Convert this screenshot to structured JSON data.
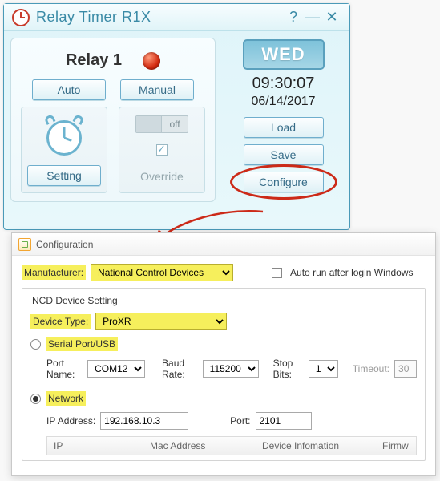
{
  "app": {
    "title": "Relay Timer R1X"
  },
  "relay": {
    "title": "Relay 1",
    "auto": "Auto",
    "manual": "Manual",
    "setting": "Setting",
    "override": "Override",
    "off": "off"
  },
  "clock": {
    "day": "WED",
    "time": "09:30:07",
    "date": "06/14/2017",
    "load": "Load",
    "save": "Save",
    "configure": "Configure"
  },
  "config": {
    "title": "Configuration",
    "manufacturer_label": "Manufacturer:",
    "manufacturer_value": "National Control Devices",
    "autorun_label": "Auto run after login Windows",
    "device_setting_legend": "NCD Device Setting",
    "device_type_label": "Device Type:",
    "device_type_value": "ProXR",
    "serial_label": "Serial Port/USB",
    "port_name_label": "Port Name:",
    "port_name_value": "COM12",
    "baud_label": "Baud Rate:",
    "baud_value": "115200",
    "stop_bits_label": "Stop Bits:",
    "stop_bits_value": "1",
    "timeout_label": "Timeout:",
    "timeout_value": "30",
    "network_label": "Network",
    "ip_label": "IP Address:",
    "ip_value": "192.168.10.3",
    "port_label": "Port:",
    "port_value": "2101",
    "th_ip": "IP",
    "th_mac": "Mac Address",
    "th_dev": "Device Infomation",
    "th_fw": "Firmw"
  }
}
